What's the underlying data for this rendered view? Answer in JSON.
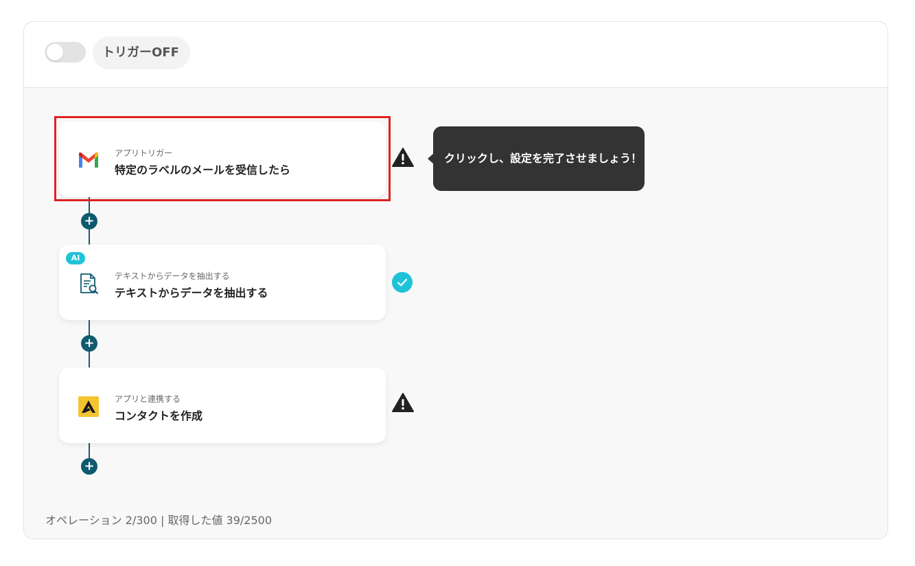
{
  "trigger": {
    "toggle_label": "トリガーOFF",
    "enabled": false
  },
  "flow": {
    "steps": [
      {
        "subtitle": "アプリトリガー",
        "title": "特定のラベルのメールを受信したら",
        "icon": "gmail-icon",
        "status": "warning"
      },
      {
        "badge": "AI",
        "subtitle": "テキストからデータを抽出する",
        "title": "テキストからデータを抽出する",
        "icon": "document-search-icon",
        "status": "complete"
      },
      {
        "subtitle": "アプリと連携する",
        "title": "コンタクトを作成",
        "icon": "app-logo-icon",
        "status": "warning"
      }
    ]
  },
  "tooltip": {
    "text": "クリックし、設定を完了させましょう！"
  },
  "footer": {
    "text": "オペレーション 2/300 | 取得した値 39/2500"
  },
  "colors": {
    "connector": "#1c5a6b",
    "plus_button": "#0f5a6e",
    "ai_badge": "#1ec3d8",
    "check": "#1ec3d8",
    "highlight": "#e02020",
    "tooltip_bg": "#333333"
  }
}
